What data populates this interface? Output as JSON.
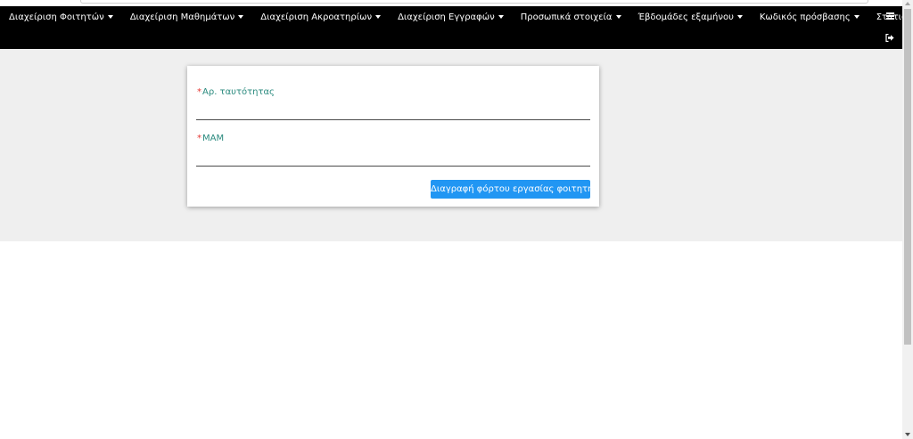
{
  "navbar": {
    "items": [
      {
        "label": "Διαχείριση Φοιτητών"
      },
      {
        "label": "Διαχείριση Μαθημάτων"
      },
      {
        "label": "Διαχείριση Ακροατηρίων"
      },
      {
        "label": "Διαχείριση Εγγραφών"
      },
      {
        "label": "Προσωπικά στοιχεία"
      },
      {
        "label": "Έβδομάδες εξαμήνου"
      },
      {
        "label": "Κωδικός πρόσβασης"
      },
      {
        "label": "Στατιστικά στοιχεία"
      }
    ],
    "menu_icon": "hamburger-icon",
    "logout_icon": "sign-out-icon"
  },
  "form": {
    "id_field": {
      "required_mark": "*",
      "label": "Αρ. ταυτότητας",
      "value": ""
    },
    "mam_field": {
      "required_mark": "*",
      "label": "ΜΑΜ",
      "value": ""
    },
    "submit_label": "Διαγραφή φόρτου εργασίας φοιτητή"
  },
  "colors": {
    "navbar_bg": "#000000",
    "content_bg": "#efefef",
    "label_color": "#2a8a7e",
    "required_color": "#e53935",
    "button_bg": "#2196f3"
  }
}
